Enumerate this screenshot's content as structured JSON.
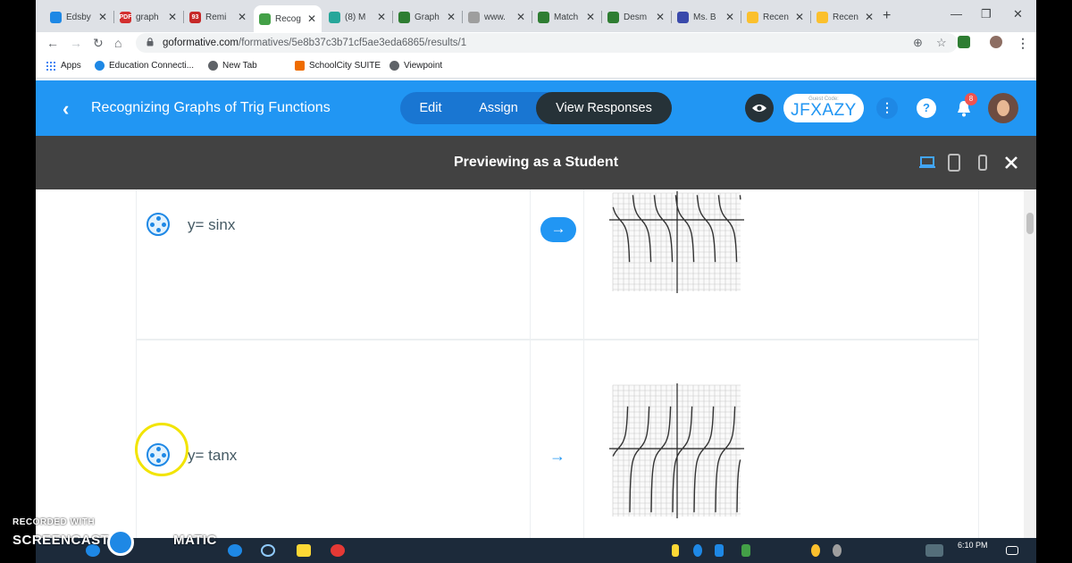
{
  "browser": {
    "tabs": [
      {
        "label": "Edsby",
        "color": "#1e88e5",
        "glyph": ""
      },
      {
        "label": "graph",
        "color": "#d32f2f",
        "glyph": "PDF"
      },
      {
        "label": "Remi",
        "color": "#c62828",
        "glyph": "93"
      },
      {
        "label": "Recog",
        "color": "#43a047",
        "glyph": ""
      },
      {
        "label": "(8) M",
        "color": "#26a69a",
        "glyph": ""
      },
      {
        "label": "Graph",
        "color": "#2e7d32",
        "glyph": ""
      },
      {
        "label": "www.",
        "color": "#9e9e9e",
        "glyph": ""
      },
      {
        "label": "Match",
        "color": "#2e7d32",
        "glyph": ""
      },
      {
        "label": "Desm",
        "color": "#2e7d32",
        "glyph": ""
      },
      {
        "label": "Ms. B",
        "color": "#3949ab",
        "glyph": ""
      },
      {
        "label": "Recen",
        "color": "#fbc02d",
        "glyph": ""
      },
      {
        "label": "Recen",
        "color": "#fbc02d",
        "glyph": ""
      }
    ],
    "url_host": "goformative.com",
    "url_path": "/formatives/5e8b37c3b71cf5ae3eda6865/results/1",
    "bookmarks": {
      "apps": "Apps",
      "b1": "Education Connecti...",
      "b2": "New Tab",
      "b3": "SchoolCity SUITE",
      "b4": "Viewpoint"
    }
  },
  "header": {
    "title": "Recognizing Graphs of Trig Functions",
    "tabs": {
      "edit": "Edit",
      "assign": "Assign",
      "view": "View Responses"
    },
    "guest_label": "Guest Code:",
    "guest_code": "JFXAZY",
    "notification_count": "8",
    "accent": "#2196f3"
  },
  "preview": {
    "title": "Previewing as a Student"
  },
  "questions": [
    {
      "label": "y=  sinx"
    },
    {
      "label": "y= tanx"
    }
  ],
  "taskbar": {
    "time": "6:10 PM"
  },
  "watermark": {
    "line1": "RECORDED WITH",
    "line2": "SCREENCAST",
    "line3": "MATIC"
  }
}
